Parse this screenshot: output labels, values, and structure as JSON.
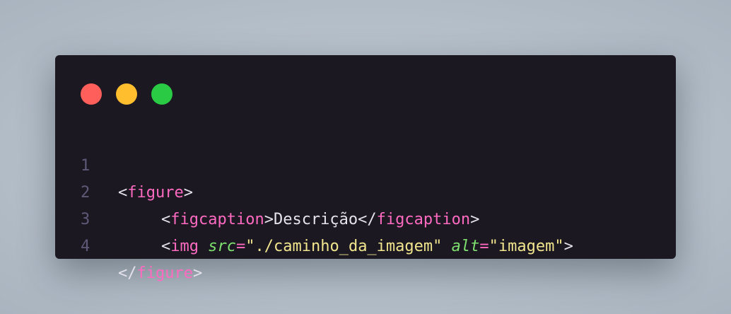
{
  "window": {
    "controls": [
      {
        "name": "close",
        "color": "#ff5f5a"
      },
      {
        "name": "minimize",
        "color": "#ffbe2e"
      },
      {
        "name": "maximize",
        "color": "#2aca44"
      }
    ]
  },
  "code": {
    "lines": [
      {
        "number": "1",
        "tokens": [
          "<",
          "figure",
          ">"
        ]
      },
      {
        "number": "2",
        "tokens": [
          "<",
          "figcaption",
          ">",
          "Descrição",
          "</",
          "figcaption",
          ">"
        ]
      },
      {
        "number": "3",
        "tokens": [
          "<",
          "img",
          " ",
          "src",
          "=",
          "\"./caminho_da_imagem\"",
          " ",
          "alt",
          "=",
          "\"imagem\"",
          ">"
        ]
      },
      {
        "number": "4",
        "tokens": [
          "</",
          "figure",
          ">"
        ]
      }
    ]
  },
  "colors": {
    "background": "#1b1822",
    "tag": "#ff6ac1",
    "punctuation": "#e6e2ec",
    "attribute": "#7ee06e",
    "string": "#f1e58d",
    "line_number": "#5f5a78"
  }
}
